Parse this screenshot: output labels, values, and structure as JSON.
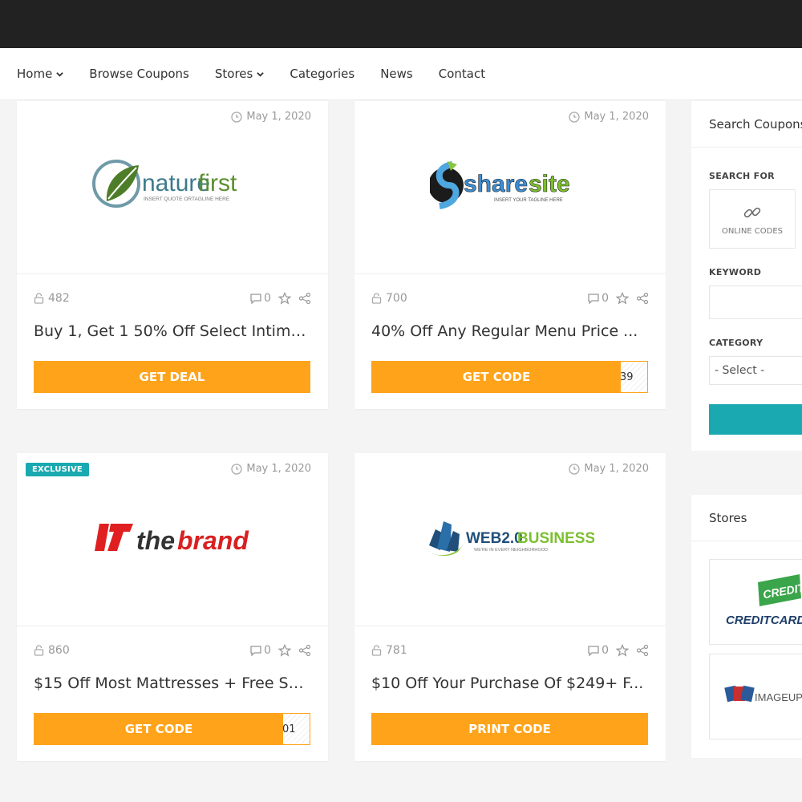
{
  "nav": {
    "items": [
      {
        "label": "Home",
        "has_dropdown": true
      },
      {
        "label": "Browse Coupons",
        "has_dropdown": false
      },
      {
        "label": "Stores",
        "has_dropdown": true
      },
      {
        "label": "Categories",
        "has_dropdown": false
      },
      {
        "label": "News",
        "has_dropdown": false
      },
      {
        "label": "Contact",
        "has_dropdown": false
      }
    ]
  },
  "coupons": [
    {
      "date": "May 1, 2020",
      "views": "482",
      "comments": "0",
      "title": "Buy 1, Get 1 50% Off Select Intima...",
      "button": "GET DEAL",
      "button_type": "deal",
      "code_peek": "",
      "badge": "",
      "logo": {
        "text_a": "nature",
        "text_b": "first",
        "tagline": "INSERT QUOTE ORTAGLINE HERE"
      }
    },
    {
      "date": "May 1, 2020",
      "views": "700",
      "comments": "0",
      "title": "40% Off Any Regular Menu Price ...",
      "button": "GET CODE",
      "button_type": "code",
      "code_peek": "39",
      "badge": "",
      "logo": {
        "text_a": "share",
        "text_b": "site",
        "tagline": "INSERT YOUR TAGLINE HERE"
      }
    },
    {
      "date": "May 1, 2020",
      "views": "860",
      "comments": "0",
      "title": "$15 Off Most Mattresses + Free Sh...",
      "button": "GET CODE",
      "button_type": "code",
      "code_peek": "01",
      "badge": "EXCLUSIVE",
      "logo": {
        "text_a": "the",
        "text_b": "brand",
        "tagline": ""
      }
    },
    {
      "date": "May 1, 2020",
      "views": "781",
      "comments": "0",
      "title": "$10 Off Your Purchase Of $249+ F...",
      "button": "PRINT CODE",
      "button_type": "deal",
      "code_peek": "",
      "badge": "",
      "logo": {
        "text_a": "WEB2.0",
        "text_b": "BUSINESS",
        "tagline": "WE'RE IN EVERY NEIGHBORHOOD"
      }
    }
  ],
  "sidebar": {
    "search": {
      "title": "Search Coupons",
      "search_for_label": "SEARCH FOR",
      "online_codes_label": "ONLINE CODES",
      "keyword_label": "KEYWORD",
      "category_label": "CATEGORY",
      "category_selected": "- Select -"
    },
    "stores": {
      "title": "Stores",
      "items": [
        {
          "text_a": "CREDIT",
          "text_b": "CREDITCARD"
        },
        {
          "text_a": "IMAGEUP",
          "text_b": ""
        }
      ]
    }
  },
  "colors": {
    "accent": "#ffa31a",
    "teal": "#1aa9b0",
    "topbar": "#222222"
  }
}
